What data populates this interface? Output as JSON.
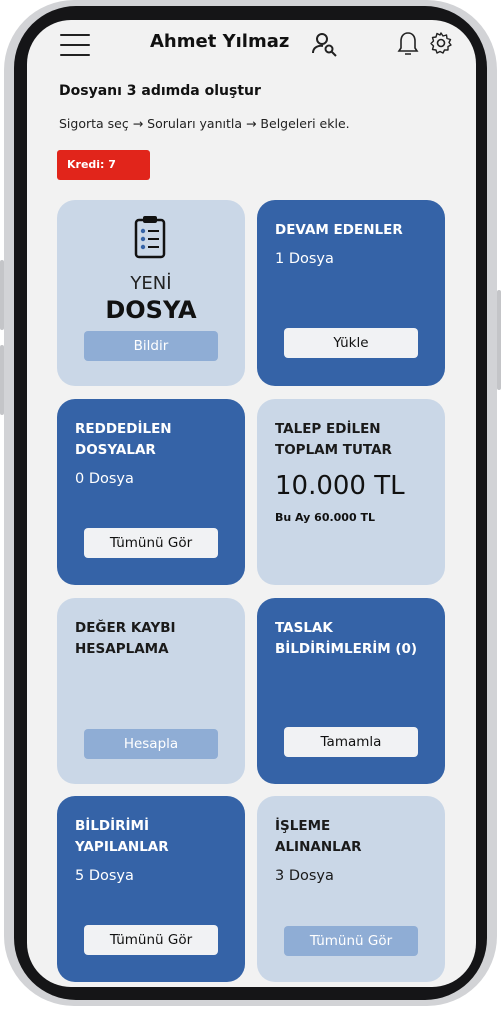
{
  "header": {
    "user_name": "Ahmet Yılmaz"
  },
  "intro": {
    "title": "Dosyanı 3 adımda oluştur",
    "subtitle": "Sigorta seç → Soruları yanıtla → Belgeleri ekle."
  },
  "credit_badge": "Kredi: 7",
  "colors": {
    "dark_card": "#3563a7",
    "light_card": "#cad7e7",
    "badge": "#e1251b"
  },
  "cards": {
    "new_file": {
      "line1": "YENİ",
      "line2": "DOSYA",
      "button": "Bildir",
      "icon": "clipboard-icon"
    },
    "in_progress": {
      "title": "DEVAM EDENLER",
      "count": "1 Dosya",
      "button": "Yükle"
    },
    "rejected": {
      "title_line1": "REDDEDİLEN",
      "title_line2": "DOSYALAR",
      "count": "0 Dosya",
      "button": "Tümünü Gör"
    },
    "total_claim": {
      "title_line1": "TALEP EDİLEN",
      "title_line2": "TOPLAM TUTAR",
      "amount": "10.000 TL",
      "month": "Bu Ay 60.000 TL"
    },
    "value_loss": {
      "title_line1": "DEĞER KAYBI",
      "title_line2": "HESAPLAMA",
      "button": "Hesapla"
    },
    "drafts": {
      "title_line1": "TASLAK",
      "title_line2": "BİLDİRİMLERİM (0)",
      "button": "Tamamla"
    },
    "reported": {
      "title_line1": "BİLDİRİMİ",
      "title_line2": "YAPILANLAR",
      "count": "5 Dosya",
      "button": "Tümünü Gör"
    },
    "processing": {
      "title_line1": "İŞLEME",
      "title_line2": "ALINANLAR",
      "count": "3 Dosya",
      "button": "Tümünü Gör"
    }
  }
}
